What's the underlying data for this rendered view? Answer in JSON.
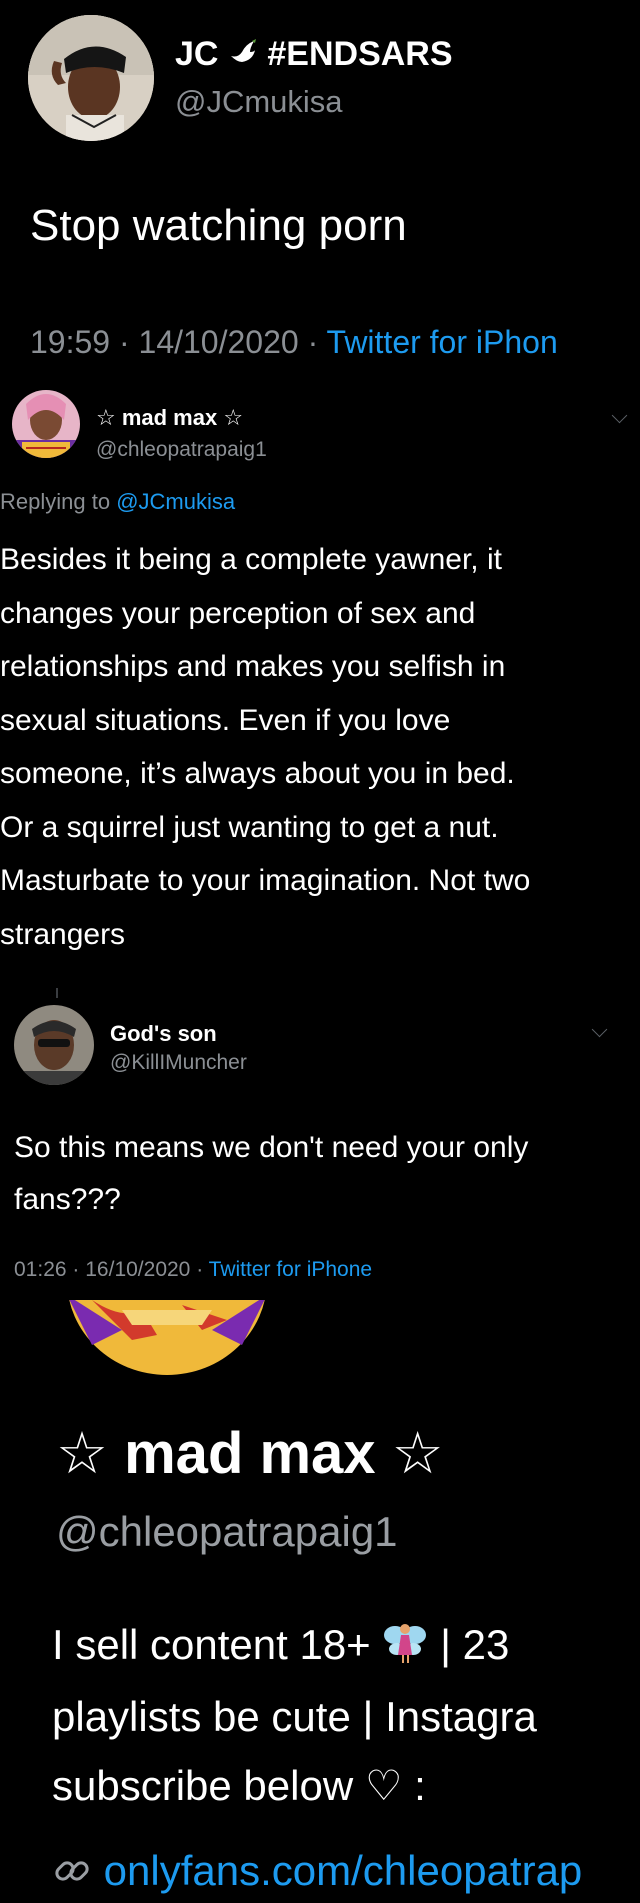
{
  "tweet1": {
    "display_name": "JC",
    "display_name_icon": "dove-icon",
    "display_name_suffix": "#ENDSARS",
    "handle": "@JCmukisa",
    "body": "Stop watching porn",
    "time": "19:59",
    "date": "14/10/2020",
    "client": "Twitter for iPhon",
    "separator": "·"
  },
  "reply1": {
    "display_name": "☆ mad max ☆",
    "handle": "@chleopatrapaig1",
    "replying_to_label": "Replying to",
    "replying_to_handle": "@JCmukisa",
    "body_lines": [
      "Besides it being a complete yawner, it",
      "changes your perception of sex and",
      "relationships and makes you selfish in",
      "sexual situations. Even if you love",
      "someone, it’s always about you in bed.",
      "Or a squirrel just wanting to get a nut.",
      "Masturbate to your imagination. Not two",
      "strangers"
    ]
  },
  "reply2": {
    "display_name": "God's son",
    "handle": "@KillIMuncher",
    "body_lines": [
      "So this means we don't need your only",
      "fans???"
    ],
    "time": "01:26",
    "date": "16/10/2020",
    "client": "Twitter for iPhone",
    "separator": "·"
  },
  "profile": {
    "display_name": "☆ mad max ☆",
    "handle": "@chleopatrapaig1",
    "bio_line1_start": "I sell content 18+",
    "bio_line1_icon": "fairy-icon",
    "bio_line1_end": "| 23",
    "bio_line2": "playlists be cute | Instagra",
    "bio_line3": "subscribe below ♡ :",
    "link_icon": "link-icon",
    "link": "onlyfans.com/chleopatrap"
  },
  "colors": {
    "background": "#000000",
    "text": "#e7e9ea",
    "muted": "#8b8f94",
    "link": "#1d9bf0"
  }
}
